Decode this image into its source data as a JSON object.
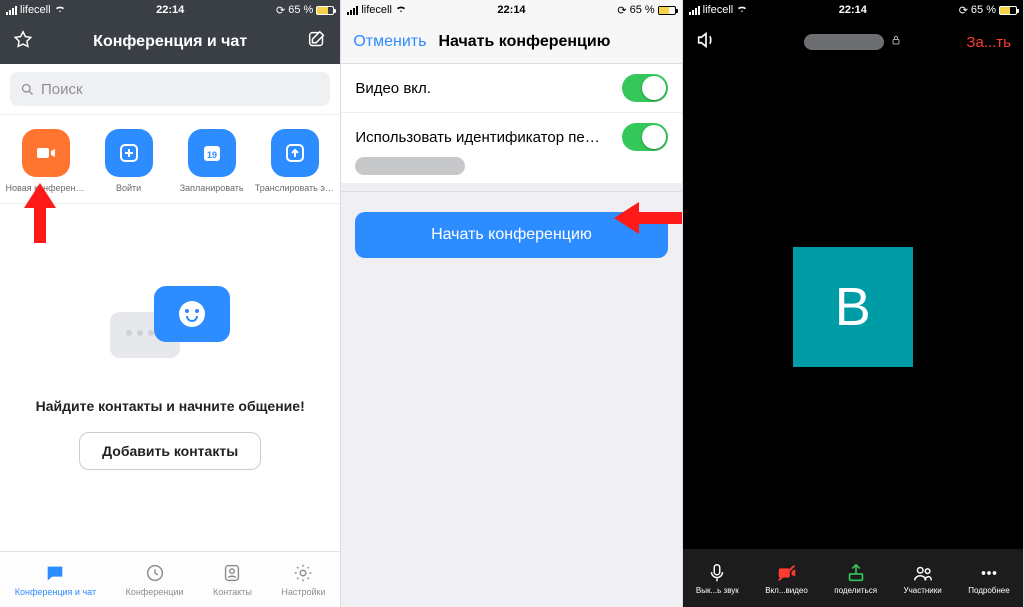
{
  "status": {
    "carrier": "lifecell",
    "time": "22:14",
    "battery": "65 %"
  },
  "screen1": {
    "title": "Конференция и чат",
    "search_placeholder": "Поиск",
    "actions": [
      {
        "label": "Новая конференция"
      },
      {
        "label": "Войти"
      },
      {
        "label": "Запланировать",
        "day": "19"
      },
      {
        "label": "Транслировать экр..."
      }
    ],
    "empty_title": "Найдите контакты и начните общение!",
    "add_contacts": "Добавить контакты",
    "tabs": [
      {
        "label": "Конференция и чат"
      },
      {
        "label": "Конференции"
      },
      {
        "label": "Контакты"
      },
      {
        "label": "Настройки"
      }
    ]
  },
  "screen2": {
    "cancel": "Отменить",
    "title": "Начать конференцию",
    "row_video": "Видео вкл.",
    "row_pmi": "Использовать идентификатор перс...",
    "start_button": "Начать конференцию"
  },
  "screen3": {
    "end": "За...ть",
    "avatar_letter": "В",
    "toolbar": [
      {
        "label": "Вык...ь звук"
      },
      {
        "label": "Вкл...видео"
      },
      {
        "label": "поделиться"
      },
      {
        "label": "Участники"
      },
      {
        "label": "Подробнее"
      }
    ]
  }
}
